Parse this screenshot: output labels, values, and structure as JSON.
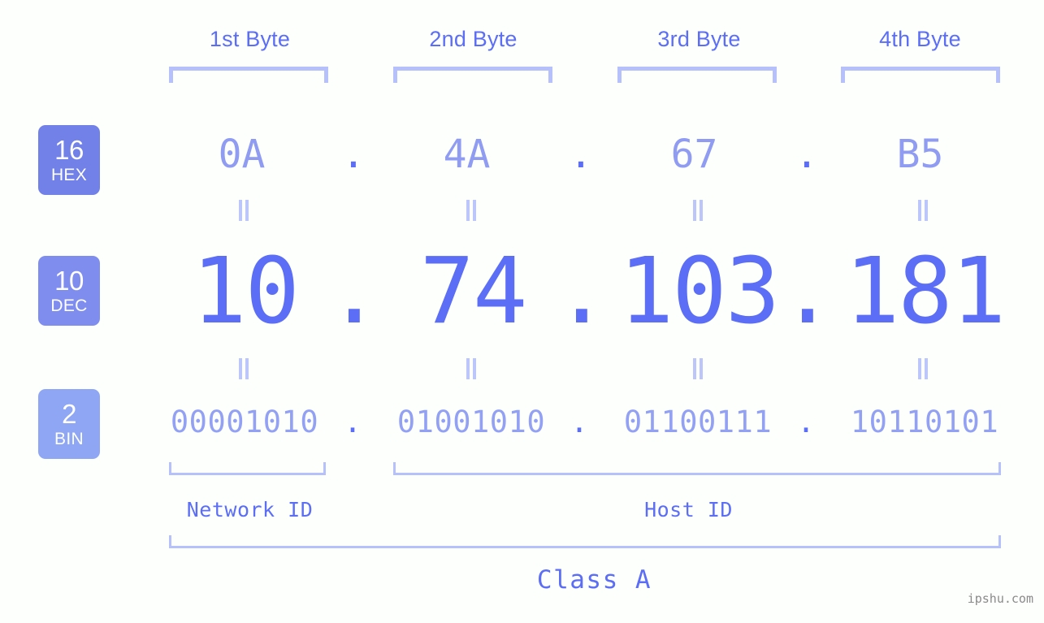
{
  "background_color": "#fdfffc",
  "accent_color": "#5b6ef5",
  "bracket_color": "#b6c0fb",
  "ip_address": "10.74.103.181",
  "byte_headers": [
    {
      "label": "1st Byte"
    },
    {
      "label": "2nd Byte"
    },
    {
      "label": "3rd Byte"
    },
    {
      "label": "4th Byte"
    }
  ],
  "rows": {
    "hex": {
      "badge_number": "16",
      "badge_name": "HEX",
      "badge_color": "#7181e8",
      "values": [
        "0A",
        "4A",
        "67",
        "B5"
      ],
      "separator": "."
    },
    "dec": {
      "badge_number": "10",
      "badge_name": "DEC",
      "badge_color": "#7f8def",
      "values": [
        "10",
        "74",
        "103",
        "181"
      ],
      "separator": "."
    },
    "bin": {
      "badge_number": "2",
      "badge_name": "BIN",
      "badge_color": "#8fa6f5",
      "values": [
        "00001010",
        "01001010",
        "01100111",
        "10110101"
      ],
      "separator": "."
    }
  },
  "equals_marks": {
    "glyph": "=",
    "count_per_gap": 4
  },
  "segments": {
    "network_id": "Network ID",
    "host_id": "Host ID",
    "class": "Class A"
  },
  "watermark": "ipshu.com"
}
